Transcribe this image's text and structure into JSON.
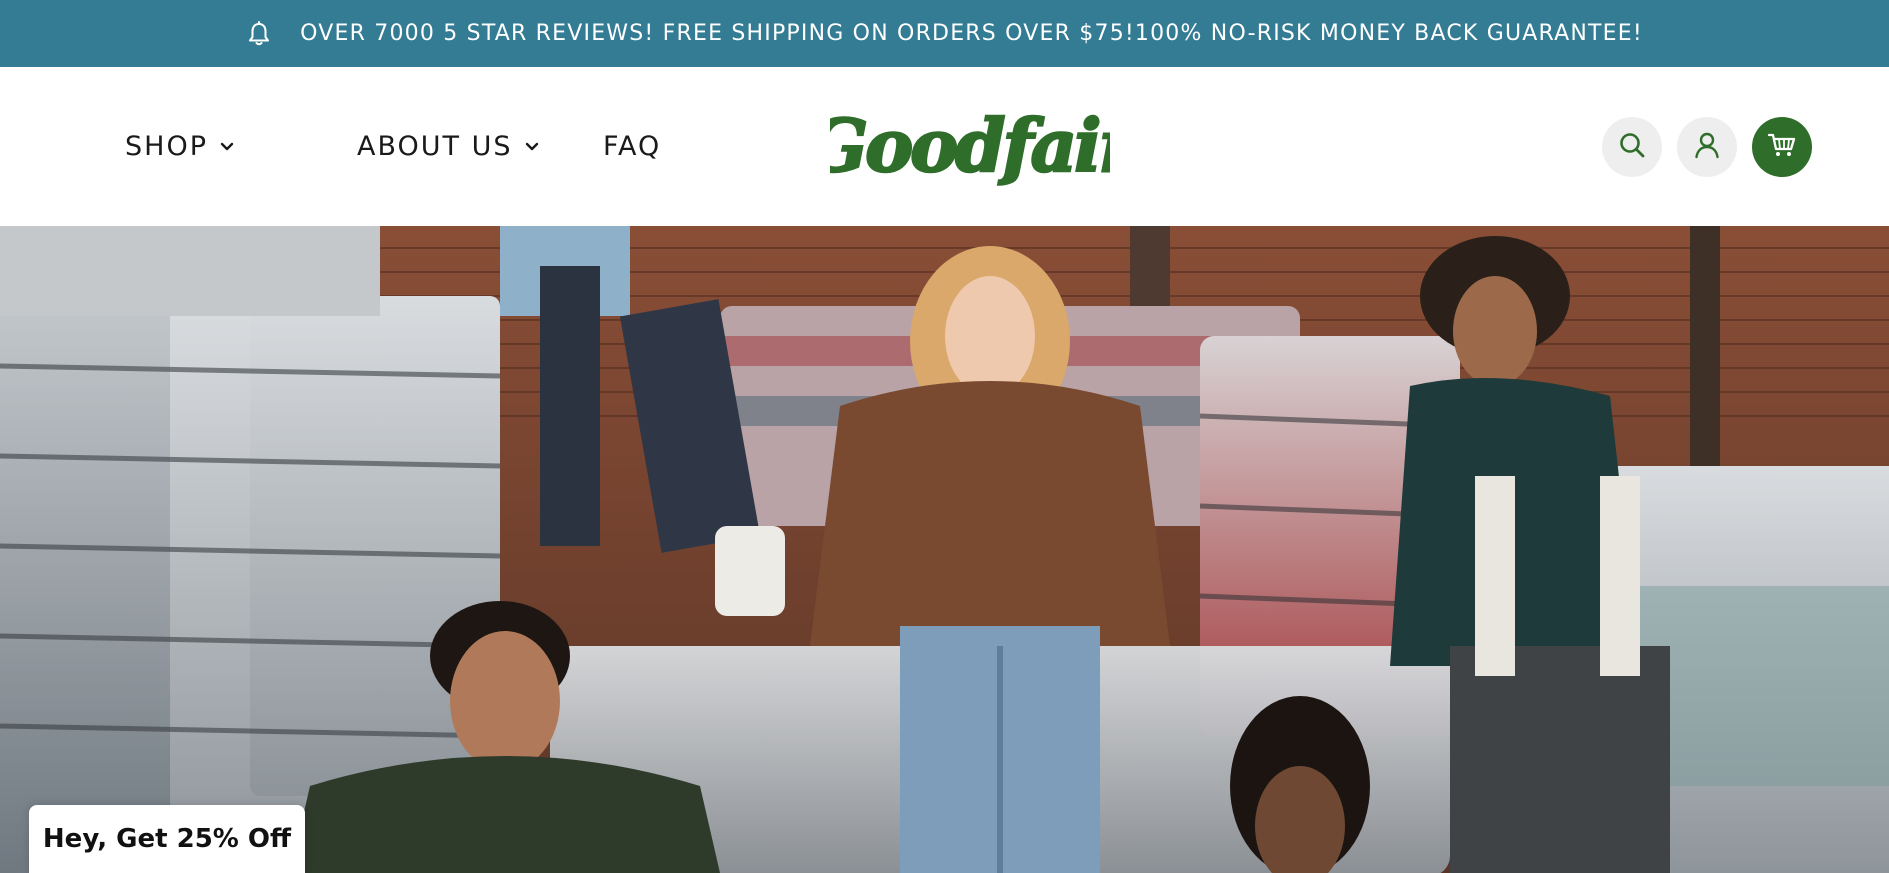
{
  "announcement": {
    "icon": "bell-icon",
    "text": "OVER 7000 5 STAR REVIEWS! FREE SHIPPING ON ORDERS OVER $75!100% NO-RISK MONEY BACK GUARANTEE!",
    "background": "#337c93"
  },
  "nav": {
    "shop": "SHOP",
    "about": "ABOUT US",
    "faq": "FAQ"
  },
  "brand": {
    "logo_text": "Goodfair",
    "logo_color": "#2f6e2a"
  },
  "header_actions": {
    "search_icon": "search-icon",
    "account_icon": "account-icon",
    "cart_icon": "cart-icon",
    "cart_color": "#2f6e2a"
  },
  "promo": {
    "label": "Hey, Get 25% Off"
  }
}
